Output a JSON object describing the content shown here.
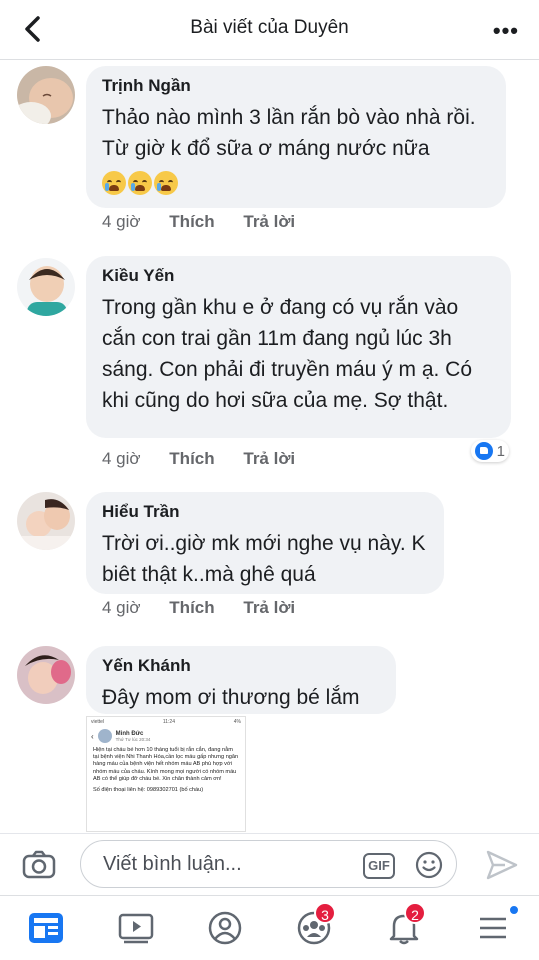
{
  "header": {
    "title": "Bài viết của Duyên",
    "more_label": "•••"
  },
  "comments": [
    {
      "author": "Trịnh Ngần",
      "text": "Thảo nào mình 3 lần rắn bò vào nhà rồi. Từ giờ k đổ sữa ơ máng nước nữa",
      "emojis": [
        "crying-face-emoji",
        "crying-face-emoji",
        "crying-face-emoji"
      ],
      "time": "4 giờ",
      "like": "Thích",
      "reply": "Trả lời"
    },
    {
      "author": "Kiều Yến",
      "text": "Trong gần khu e ở đang có vụ rắn vào cắn con trai gần 11m đang ngủ lúc 3h sáng. Con phải đi truyền máu ý m ạ. Có khi cũng do hơi sữa của mẹ. Sợ thật.",
      "time": "4 giờ",
      "like": "Thích",
      "reply": "Trả lời",
      "reaction_count": "1"
    },
    {
      "author": "Hiểu Trần",
      "text": "Trời ơi..giờ mk mới nghe vụ này. K biêt thật k..mà ghê quá",
      "time": "4 giờ",
      "like": "Thích",
      "reply": "Trả lời"
    },
    {
      "author": "Yến Khánh",
      "text": "Đây mom ơi thương bé lắm"
    }
  ],
  "shared_screenshot": {
    "status_left": "viettel",
    "status_time": "11:24",
    "status_right": "4%",
    "poster_name": "Minh Đức",
    "poster_time": "Thứ Tư lúc 20:34",
    "body": "Hiện tại cháu bé hơn 10 tháng tuổi bị rắn cắn, đang nằm tại bệnh viện Nhi Thanh Hóa,cần lọc máu gấp nhưng ngân hàng máu của bệnh viện hết nhóm máu AB phù hợp với nhóm máu của cháu. Kính mong mọi người có nhóm máu AB có thể giúp đỡ cháu bé. Xin chân thành cảm ơn!",
    "phone": "Số điện thoại liên hệ: 0989302701 (bố cháu)"
  },
  "composer": {
    "placeholder": "Viết bình luận...",
    "gif_label": "GIF"
  },
  "nav": {
    "groups_badge": "3",
    "notifications_badge": "2"
  },
  "colors": {
    "accent": "#1877f2",
    "badge": "#e41e3f",
    "bubble": "#f0f2f5"
  }
}
